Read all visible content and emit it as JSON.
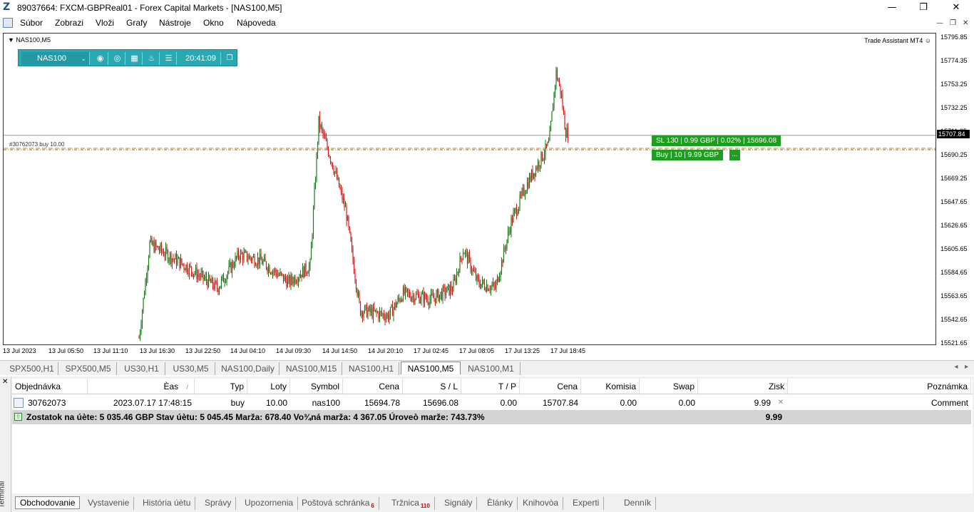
{
  "window": {
    "title": "89037664: FXCM-GBPReal01 - Forex Capital Markets - [NAS100,M5]"
  },
  "menu": [
    "Súbor",
    "Zobrazi",
    "Vloži",
    "Grafy",
    "Nástroje",
    "Okno",
    "Nápoveda"
  ],
  "chart": {
    "symbol_label": "NAS100,M5",
    "trade_assistant": "Trade Assistant MT4",
    "toolbar": {
      "symbol": "NAS100",
      "time": "20:41:09"
    },
    "sl_label": "SL 130 | 0.99 GBP | 0.02% | 15696.08",
    "buy_label": "Buy | 10 | 9.99 GBP",
    "buy_more": "...",
    "order_line_label": "#30762073 buy 10.00",
    "current_price": "15707.84",
    "price_ticks": [
      "15795.85",
      "15774.35",
      "15753.25",
      "15732.25",
      "15711.25",
      "15690.25",
      "15669.25",
      "15647.65",
      "15626.65",
      "15605.65",
      "15584.65",
      "15563.65",
      "15542.65",
      "15521.65"
    ],
    "time_ticks": [
      "13 Jul 2023",
      "13 Jul 05:50",
      "13 Jul 11:10",
      "13 Jul 16:30",
      "13 Jul 22:50",
      "14 Jul 04:10",
      "14 Jul 09:30",
      "14 Jul 14:50",
      "14 Jul 20:10",
      "17 Jul 02:45",
      "17 Jul 08:05",
      "17 Jul 13:25",
      "17 Jul 18:45"
    ],
    "colors": {
      "bull": "#1a7a1a",
      "bear": "#d11a1a",
      "level": "#c87d1a"
    }
  },
  "chart_data": {
    "type": "line",
    "title": "NAS100,M5",
    "xlabel": "",
    "ylabel": "",
    "ylim": [
      15521.65,
      15795.85
    ],
    "x": [
      "13 Jul 16:30",
      "13 Jul 17:30",
      "13 Jul 19:00",
      "13 Jul 22:50",
      "14 Jul 02:00",
      "14 Jul 04:10",
      "14 Jul 07:00",
      "14 Jul 09:30",
      "14 Jul 10:00",
      "14 Jul 12:00",
      "14 Jul 14:50",
      "14 Jul 16:30",
      "14 Jul 18:00",
      "14 Jul 20:10",
      "14 Jul 22:00",
      "17 Jul 02:45",
      "17 Jul 06:00",
      "17 Jul 08:05",
      "17 Jul 10:00",
      "17 Jul 12:00",
      "17 Jul 13:25",
      "17 Jul 15:00",
      "17 Jul 17:00",
      "17 Jul 18:30",
      "17 Jul 18:45",
      "17 Jul 19:10",
      "17 Jul 20:40"
    ],
    "series": [
      {
        "values": [
          15525,
          15610,
          15590,
          15570,
          15600,
          15595,
          15575,
          15590,
          15720,
          15685,
          15640,
          15550,
          15545,
          15565,
          15560,
          15570,
          15605,
          15575,
          15570,
          15630,
          15665,
          15685,
          15700,
          15765,
          15745,
          15712,
          15707.84
        ]
      }
    ],
    "levels": {
      "open_price": 15694.78,
      "stop_loss": 15696.08,
      "current": 15707.84
    }
  },
  "chart_tabs": [
    "SPX500,H1",
    "SPX500,M5",
    "US30,H1",
    "US30,M5",
    "NAS100,Daily",
    "NAS100,M15",
    "NAS100,H1",
    "NAS100,M5",
    "NAS100,M1"
  ],
  "active_chart_tab": "NAS100,M5",
  "terminal": {
    "label": "Terminál",
    "columns": [
      "Objednávka",
      "Èas",
      "Typ",
      "Loty",
      "Symbol",
      "Cena",
      "S / L",
      "T / P",
      "Cena",
      "Komisia",
      "Swap",
      "Zisk",
      "Poznámka"
    ],
    "sort_indicator": "/",
    "order": {
      "id": "30762073",
      "time": "2023.07.17 17:48:15",
      "type": "buy",
      "lots": "10.00",
      "symbol": "nas100",
      "price": "15694.78",
      "sl": "15696.08",
      "tp": "0.00",
      "current": "15707.84",
      "commission": "0.00",
      "swap": "0.00",
      "profit": "9.99",
      "comment": "Comment"
    },
    "balance_text": "Zostatok na úète: 5 035.46 GBP  Stav úètu: 5 045.45  Marža: 678.40  Vo¾ná marža: 4 367.05  Úroveò marže: 743.73%",
    "balance_profit": "9.99",
    "tabs": [
      {
        "label": "Obchodovanie"
      },
      {
        "label": "Vystavenie"
      },
      {
        "label": "História úètu"
      },
      {
        "label": "Správy"
      },
      {
        "label": "Upozornenia"
      },
      {
        "label": "Poštová schránka",
        "badge": "6"
      },
      {
        "label": "Tržnica",
        "badge": "110"
      },
      {
        "label": "Signály"
      },
      {
        "label": "Èlánky"
      },
      {
        "label": "Knihovòa"
      },
      {
        "label": "Experti"
      },
      {
        "label": "Denník"
      }
    ]
  }
}
